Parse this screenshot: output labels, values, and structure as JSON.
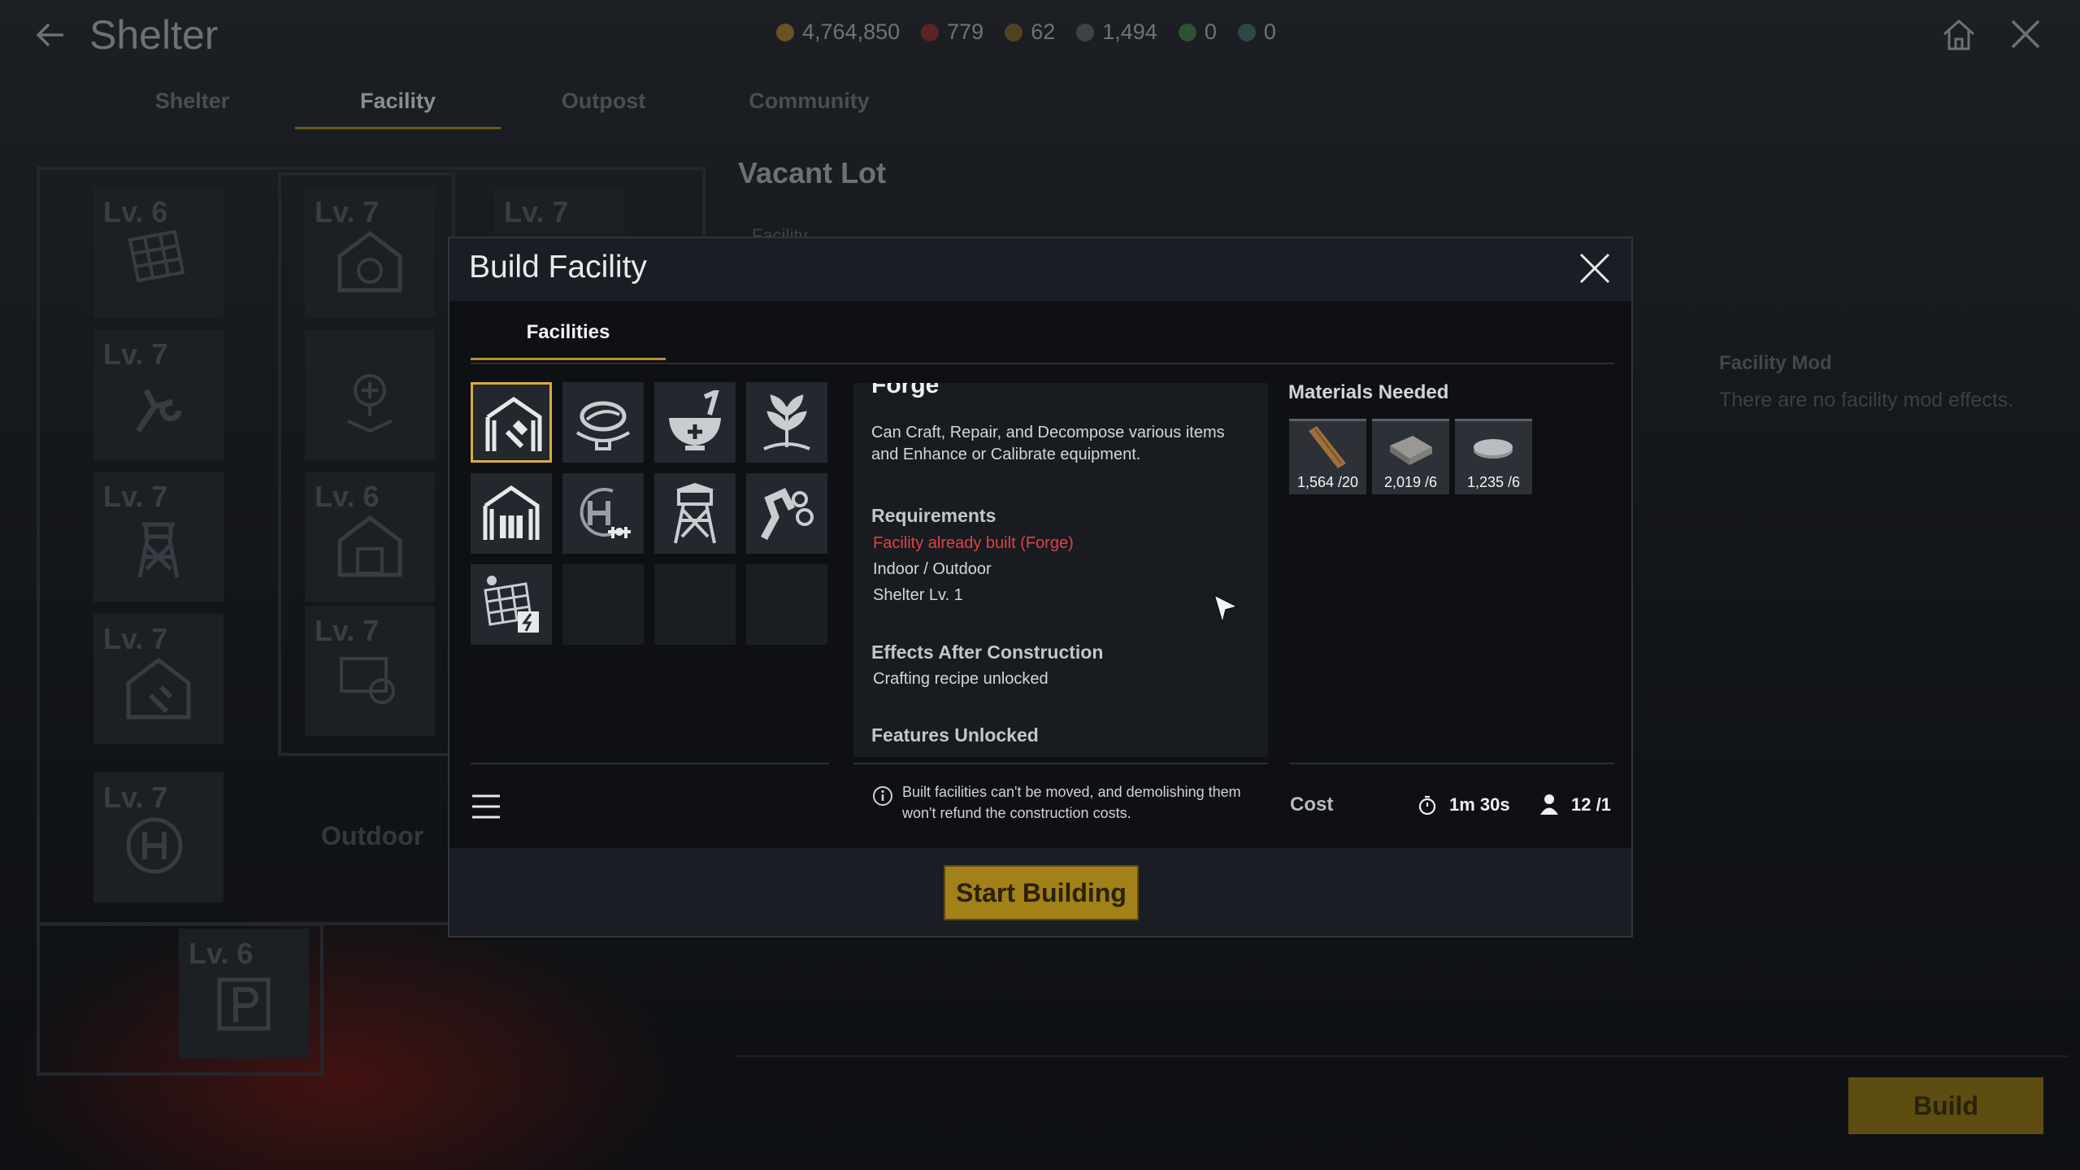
{
  "header": {
    "title": "Shelter",
    "currencies": [
      "4,764,850",
      "779",
      "62",
      "1,494",
      "0",
      "0"
    ]
  },
  "top_tabs": [
    "Shelter",
    "Facility",
    "Outpost",
    "Community"
  ],
  "map": {
    "tiles": [
      "Lv. 6",
      "Lv. 7",
      "Lv. 7",
      "Lv. 7",
      "Lv. 7",
      "Lv. 6",
      "Lv. 7",
      "Lv. 7",
      "Lv. 7",
      "Lv. 6"
    ],
    "outdoor_label": "Outdoor"
  },
  "background_panel": {
    "title": "Vacant Lot",
    "subtitle": "Facility",
    "mod_title": "Facility Mod",
    "mod_text": "There are no facility mod effects.",
    "build_label": "Build"
  },
  "modal": {
    "title": "Build Facility",
    "tab": "Facilities",
    "detail": {
      "name": "Forge",
      "description": "Can Craft, Repair, and Decompose various items and Enhance or Calibrate equipment.",
      "requirements_title": "Requirements",
      "requirements": [
        "Facility already built (Forge)",
        "Indoor / Outdoor",
        "Shelter Lv. 1"
      ],
      "effects_title": "Effects After Construction",
      "effects": [
        "Crafting recipe unlocked"
      ],
      "features_title": "Features Unlocked"
    },
    "note": "Built facilities can't be moved, and demolishing them won't refund the construction costs.",
    "materials_title": "Materials Needed",
    "materials": [
      {
        "icon": "wood-plank-icon",
        "count": "1,564 /20"
      },
      {
        "icon": "metal-plate-icon",
        "count": "2,019 /6"
      },
      {
        "icon": "steel-ingot-icon",
        "count": "1,235 /6"
      }
    ],
    "cost_label": "Cost",
    "time": "1m 30s",
    "workers": "12 /1",
    "start_label": "Start Building"
  },
  "colors": {
    "accent_gold": "#b4912b",
    "warning_red": "#e04242",
    "button_gold": "#a28118"
  }
}
